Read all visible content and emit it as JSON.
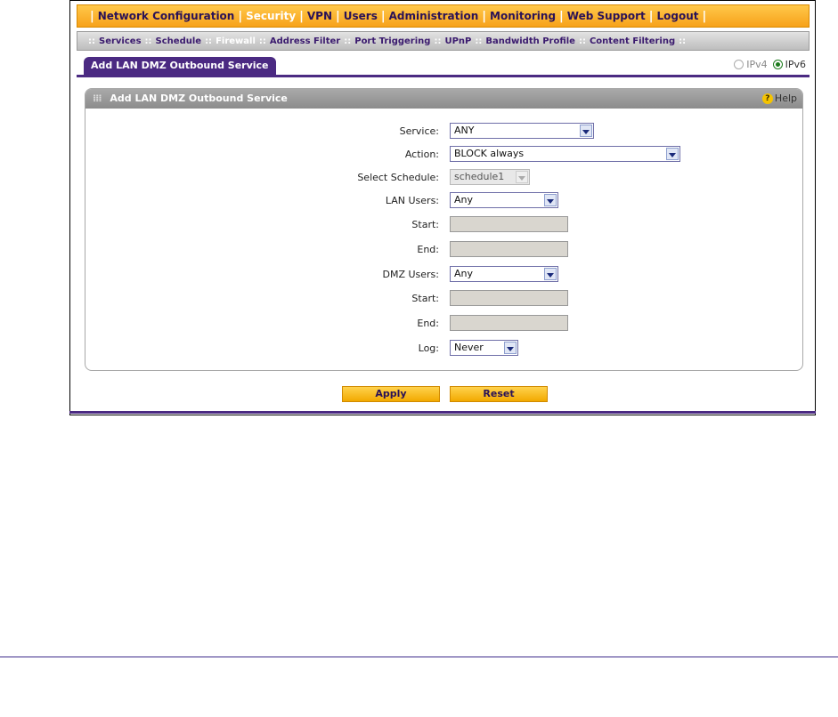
{
  "topnav": {
    "items": [
      {
        "label": "Network Configuration",
        "active": false
      },
      {
        "label": "Security",
        "active": true
      },
      {
        "label": "VPN",
        "active": false
      },
      {
        "label": "Users",
        "active": false
      },
      {
        "label": "Administration",
        "active": false
      },
      {
        "label": "Monitoring",
        "active": false
      },
      {
        "label": "Web Support",
        "active": false
      },
      {
        "label": "Logout",
        "active": false
      }
    ]
  },
  "subnav": {
    "items": [
      {
        "label": "Services",
        "active": false
      },
      {
        "label": "Schedule",
        "active": false
      },
      {
        "label": "Firewall",
        "active": true
      },
      {
        "label": "Address Filter",
        "active": false
      },
      {
        "label": "Port Triggering",
        "active": false
      },
      {
        "label": "UPnP",
        "active": false
      },
      {
        "label": "Bandwidth Profile",
        "active": false
      },
      {
        "label": "Content Filtering",
        "active": false
      }
    ]
  },
  "tab": {
    "label": "Add LAN DMZ Outbound Service"
  },
  "ip_version": {
    "ipv4": "IPv4",
    "ipv6": "IPv6",
    "selected": "IPv6"
  },
  "panel": {
    "title": "Add LAN DMZ Outbound Service",
    "help": "Help"
  },
  "form": {
    "service": {
      "label": "Service:",
      "value": "ANY"
    },
    "action": {
      "label": "Action:",
      "value": "BLOCK always"
    },
    "schedule": {
      "label": "Select Schedule:",
      "value": "schedule1"
    },
    "lan_users": {
      "label": "LAN Users:",
      "value": "Any"
    },
    "lan_start": {
      "label": "Start:",
      "value": ""
    },
    "lan_end": {
      "label": "End:",
      "value": ""
    },
    "dmz_users": {
      "label": "DMZ Users:",
      "value": "Any"
    },
    "dmz_start": {
      "label": "Start:",
      "value": ""
    },
    "dmz_end": {
      "label": "End:",
      "value": ""
    },
    "log": {
      "label": "Log:",
      "value": "Never"
    }
  },
  "buttons": {
    "apply": "Apply",
    "reset": "Reset"
  },
  "colors": {
    "accent": "#f7a21a",
    "purple": "#4b2a82"
  }
}
